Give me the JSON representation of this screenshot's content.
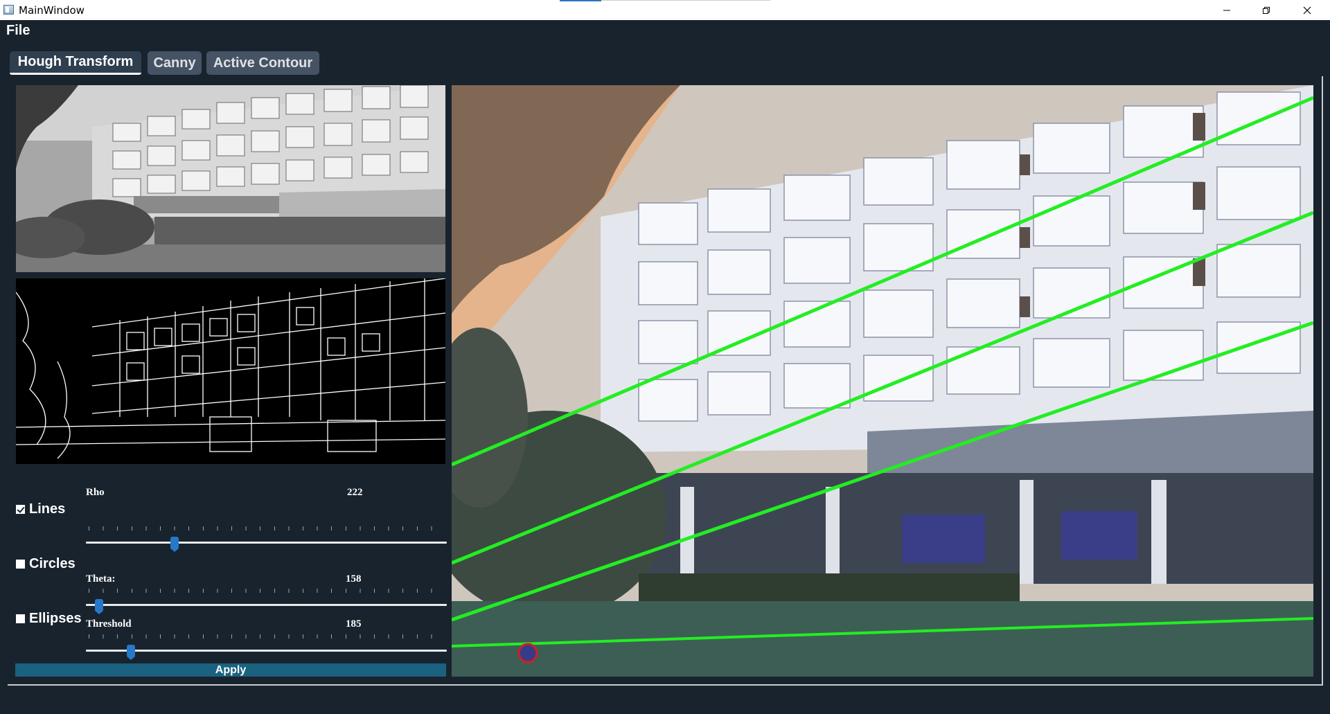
{
  "window": {
    "title": "MainWindow",
    "controls": {
      "minimize_icon": "minimize-icon",
      "maximize_icon": "restore-icon",
      "close_icon": "close-icon"
    }
  },
  "menubar": {
    "file_label": "File"
  },
  "tabs": [
    {
      "label": "Hough Transform",
      "active": true
    },
    {
      "label": "Canny",
      "active": false
    },
    {
      "label": "Active Contour",
      "active": false
    }
  ],
  "options": {
    "lines": {
      "label": "Lines",
      "checked": true
    },
    "circles": {
      "label": "Circles",
      "checked": false
    },
    "ellipses": {
      "label": "Ellipses",
      "checked": false
    }
  },
  "sliders": {
    "rho": {
      "label": "Rho",
      "value": "222",
      "position_fraction": 0.245
    },
    "theta": {
      "label": "Theta:",
      "value": "158",
      "position_fraction": 0.036
    },
    "threshold": {
      "label": "Threshold",
      "value": "185",
      "position_fraction": 0.125
    }
  },
  "apply_label": "Apply",
  "colors": {
    "background": "#19232d",
    "tab_bg": "#455364",
    "apply_bg": "#1a6280",
    "slider_handle": "#2678c9",
    "detected_line": "#22ee22"
  }
}
